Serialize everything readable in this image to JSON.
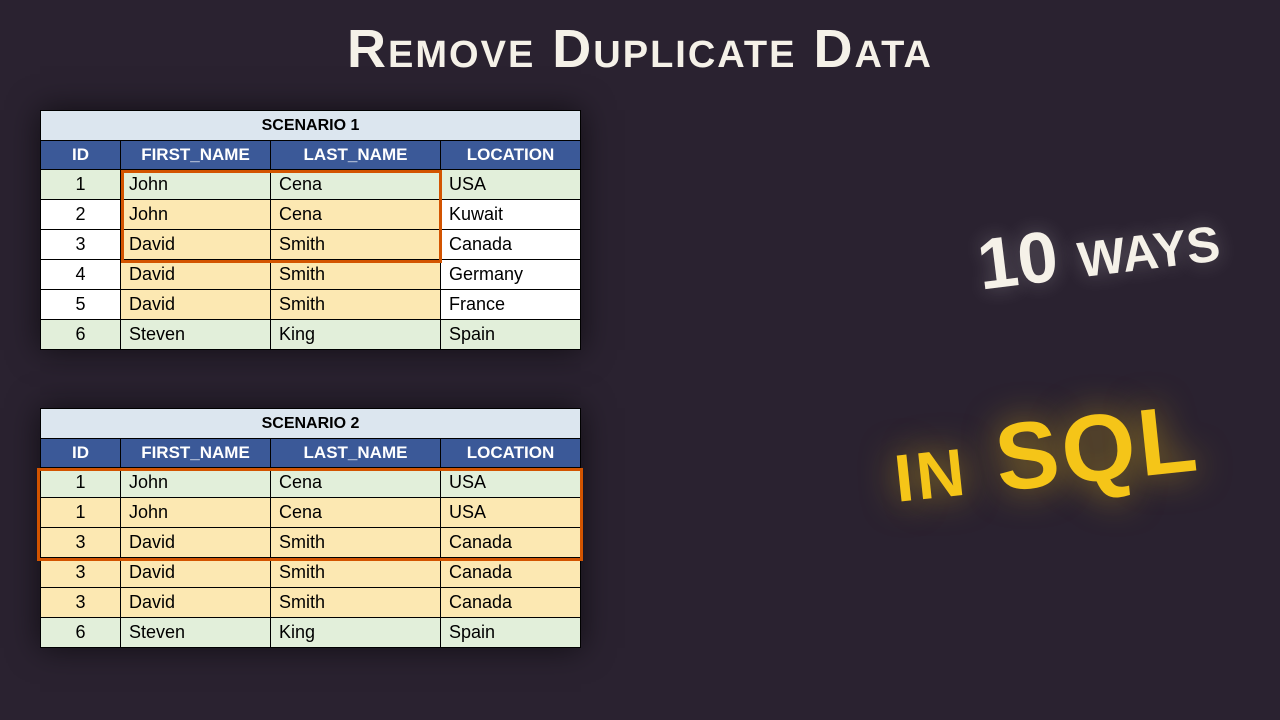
{
  "title": "Remove Duplicate Data",
  "callout1": "10 ways",
  "callout2": "in SQL",
  "table1": {
    "scenario": "SCENARIO 1",
    "headers": {
      "id": "ID",
      "fname": "FIRST_NAME",
      "lname": "LAST_NAME",
      "loc": "LOCATION"
    },
    "rows": [
      {
        "id": "1",
        "fname": "John",
        "lname": "Cena",
        "loc": "USA"
      },
      {
        "id": "2",
        "fname": "John",
        "lname": "Cena",
        "loc": "Kuwait"
      },
      {
        "id": "3",
        "fname": "David",
        "lname": "Smith",
        "loc": "Canada"
      },
      {
        "id": "4",
        "fname": "David",
        "lname": "Smith",
        "loc": "Germany"
      },
      {
        "id": "5",
        "fname": "David",
        "lname": "Smith",
        "loc": "France"
      },
      {
        "id": "6",
        "fname": "Steven",
        "lname": "King",
        "loc": "Spain"
      }
    ]
  },
  "table2": {
    "scenario": "SCENARIO 2",
    "headers": {
      "id": "ID",
      "fname": "FIRST_NAME",
      "lname": "LAST_NAME",
      "loc": "LOCATION"
    },
    "rows": [
      {
        "id": "1",
        "fname": "John",
        "lname": "Cena",
        "loc": "USA"
      },
      {
        "id": "1",
        "fname": "John",
        "lname": "Cena",
        "loc": "USA"
      },
      {
        "id": "3",
        "fname": "David",
        "lname": "Smith",
        "loc": "Canada"
      },
      {
        "id": "3",
        "fname": "David",
        "lname": "Smith",
        "loc": "Canada"
      },
      {
        "id": "3",
        "fname": "David",
        "lname": "Smith",
        "loc": "Canada"
      },
      {
        "id": "6",
        "fname": "Steven",
        "lname": "King",
        "loc": "Spain"
      }
    ]
  }
}
